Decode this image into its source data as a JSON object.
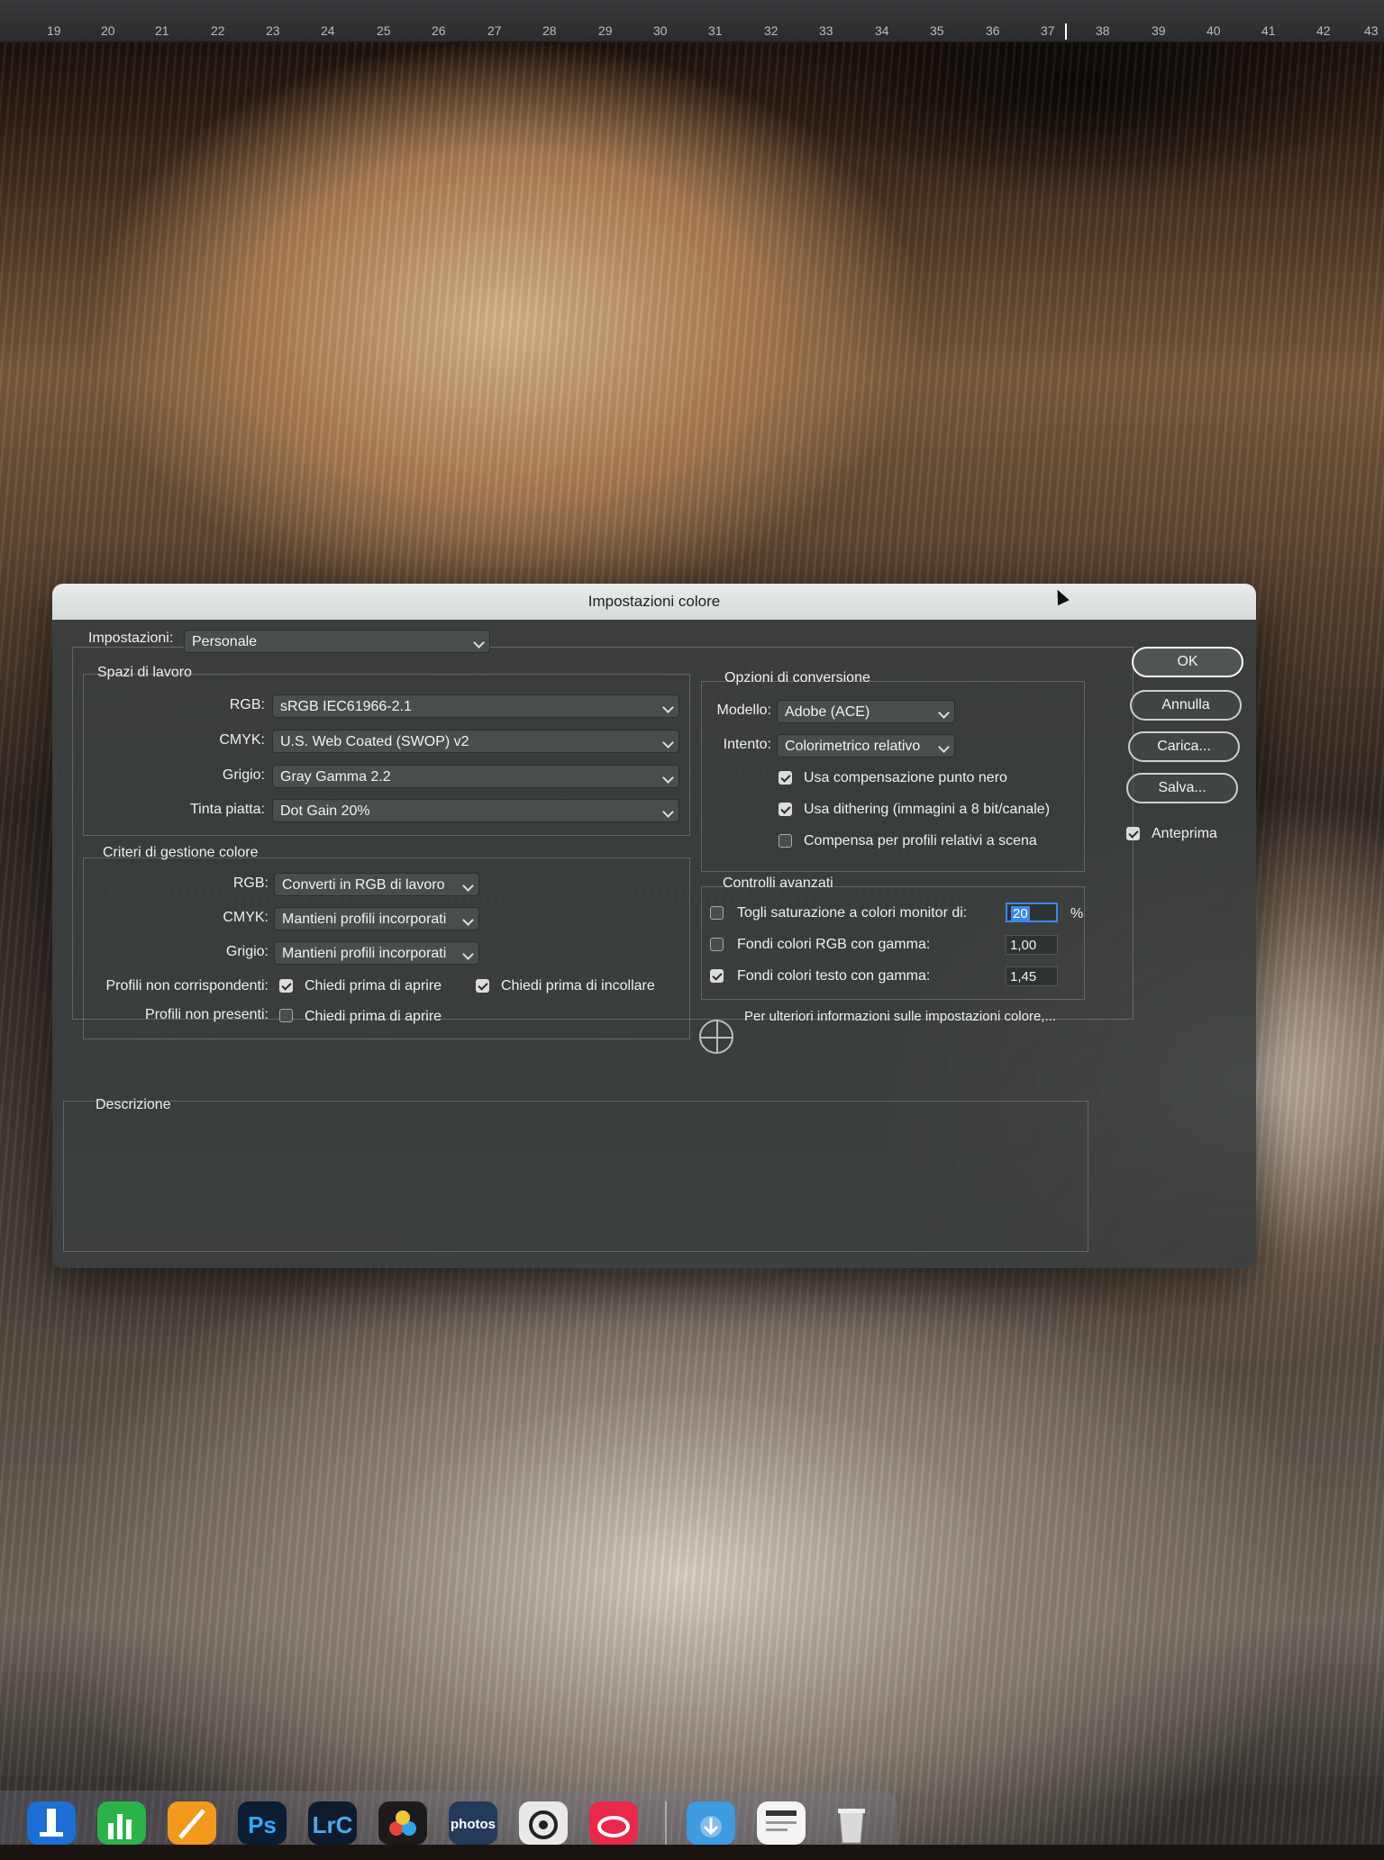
{
  "ruler": {
    "numbers": [
      "19",
      "20",
      "21",
      "22",
      "23",
      "24",
      "25",
      "26",
      "27",
      "28",
      "29",
      "30",
      "31",
      "32",
      "33",
      "34",
      "35",
      "36",
      "37",
      "38",
      "39",
      "40",
      "41",
      "42",
      "43"
    ]
  },
  "dialog": {
    "title": "Impostazioni colore",
    "settings": {
      "label": "Impostazioni:",
      "value": "Personale"
    },
    "working_spaces": {
      "title": "Spazi di lavoro",
      "rgb": {
        "label": "RGB:",
        "value": "sRGB IEC61966-2.1"
      },
      "cmyk": {
        "label": "CMYK:",
        "value": "U.S. Web Coated (SWOP) v2"
      },
      "gray": {
        "label": "Grigio:",
        "value": "Gray Gamma 2.2"
      },
      "spot": {
        "label": "Tinta piatta:",
        "value": "Dot Gain 20%"
      }
    },
    "policies": {
      "title": "Criteri di gestione colore",
      "rgb": {
        "label": "RGB:",
        "value": "Converti in RGB di lavoro"
      },
      "cmyk": {
        "label": "CMYK:",
        "value": "Mantieni profili incorporati"
      },
      "gray": {
        "label": "Grigio:",
        "value": "Mantieni profili incorporati"
      },
      "mismatch": {
        "label": "Profili non corrispondenti:",
        "ask_open": "Chiedi prima di aprire",
        "ask_paste": "Chiedi prima di incollare"
      },
      "missing": {
        "label": "Profili non presenti:",
        "ask_open": "Chiedi prima di aprire"
      }
    },
    "conversion": {
      "title": "Opzioni di conversione",
      "engine": {
        "label": "Modello:",
        "value": "Adobe (ACE)"
      },
      "intent": {
        "label": "Intento:",
        "value": "Colorimetrico relativo"
      },
      "black_point": "Usa compensazione punto nero",
      "dither": "Usa dithering (immagini a 8 bit/canale)",
      "scene": "Compensa per profili relativi a scena"
    },
    "advanced": {
      "title": "Controlli avanzati",
      "desaturate": {
        "label": "Togli saturazione a colori monitor di:",
        "value": "20",
        "unit": "%"
      },
      "blend_rgb": {
        "label": "Fondi colori RGB con gamma:",
        "value": "1,00"
      },
      "blend_text": {
        "label": "Fondi colori testo con gamma:",
        "value": "1,45"
      }
    },
    "info_text": "Per ulteriori informazioni sulle impostazioni colore,...",
    "description": {
      "title": "Descrizione"
    },
    "buttons": {
      "ok": "OK",
      "cancel": "Annulla",
      "load": "Carica...",
      "save": "Salva..."
    },
    "preview": "Anteprima"
  },
  "dock": {
    "items": [
      {
        "name": "keynote-icon",
        "label": ""
      },
      {
        "name": "numbers-icon",
        "label": ""
      },
      {
        "name": "pages-icon",
        "label": ""
      },
      {
        "name": "photoshop-icon",
        "label": "Ps"
      },
      {
        "name": "lightroom-classic-icon",
        "label": "LrC"
      },
      {
        "name": "davinci-resolve-icon",
        "label": ""
      },
      {
        "name": "amazon-photos-icon",
        "label": "photos"
      },
      {
        "name": "chatgpt-icon",
        "label": ""
      },
      {
        "name": "creative-cloud-icon",
        "label": ""
      },
      {
        "name": "downloads-folder-icon",
        "label": ""
      },
      {
        "name": "document-icon",
        "label": ""
      },
      {
        "name": "trash-icon",
        "label": ""
      }
    ]
  }
}
